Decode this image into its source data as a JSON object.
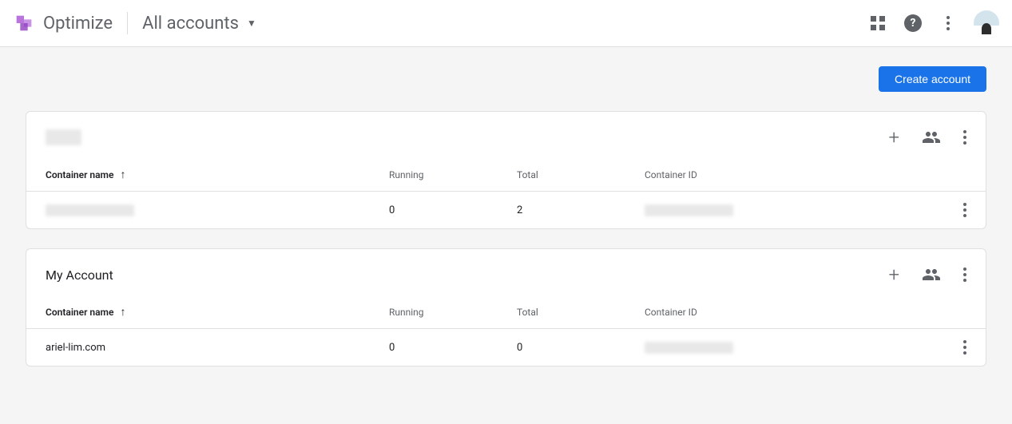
{
  "header": {
    "product_name": "Optimize",
    "account_selector_label": "All accounts"
  },
  "action_bar": {
    "create_account_label": "Create account"
  },
  "columns": {
    "container_name": "Container name",
    "running": "Running",
    "total": "Total",
    "container_id": "Container ID"
  },
  "accounts": [
    {
      "name": "████",
      "name_redacted": true,
      "containers": [
        {
          "name": "████████████",
          "name_redacted": true,
          "running": "0",
          "total": "2",
          "container_id": "████████████",
          "container_id_redacted": true
        }
      ]
    },
    {
      "name": "My Account",
      "name_redacted": false,
      "containers": [
        {
          "name": "ariel-lim.com",
          "name_redacted": false,
          "running": "0",
          "total": "0",
          "container_id": "████████████",
          "container_id_redacted": true
        }
      ]
    }
  ]
}
